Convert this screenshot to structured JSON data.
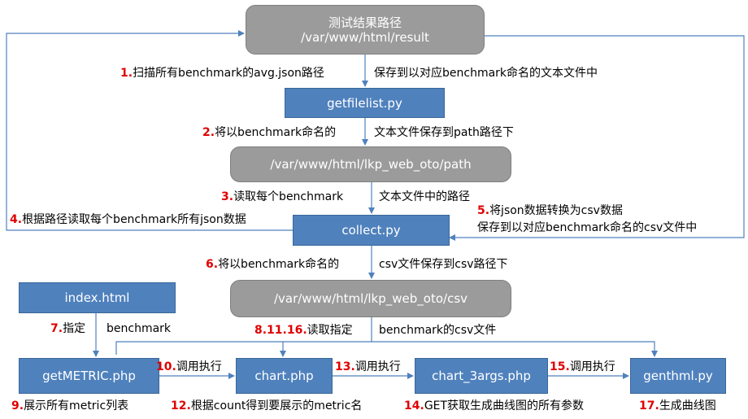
{
  "nodes": {
    "result": {
      "line1": "测试结果路径",
      "line2": "/var/www/html/result"
    },
    "getfilelist": "getfilelist.py",
    "path": "/var/www/html/lkp_web_oto/path",
    "collect": "collect.py",
    "csv": "/var/www/html/lkp_web_oto/csv",
    "index": "index.html",
    "getmetric": "getMETRIC.php",
    "chart": "chart.php",
    "chart3": "chart_3args.php",
    "genthml": "genthml.py"
  },
  "labels": {
    "s1": {
      "num": "1.",
      "text": "扫描所有benchmark的avg.json路径"
    },
    "s1b": {
      "text": "保存到以对应benchmark命名的文本文件中"
    },
    "s2": {
      "num": "2.",
      "text": "将以benchmark命名的"
    },
    "s2b": {
      "text": "文本文件保存到path路径下"
    },
    "s3": {
      "num": "3.",
      "text": "读取每个benchmark"
    },
    "s3b": {
      "text": "文本文件中的路径"
    },
    "s4": {
      "num": "4.",
      "text": "根据路径读取每个benchmark所有json数据"
    },
    "s5": {
      "num": "5.",
      "text": "将json数据转换为csv数据"
    },
    "s5b": {
      "text": "保存到以对应benchmark命名的csv文件中"
    },
    "s6": {
      "num": "6.",
      "text": "将以benchmark命名的"
    },
    "s6b": {
      "text": "csv文件保存到csv路径下"
    },
    "s7": {
      "num": "7.",
      "text": "指定"
    },
    "s7b": {
      "text": "benchmark"
    },
    "s8": {
      "num": "8.11.16.",
      "text": "读取指定"
    },
    "s8b": {
      "text": "benchmark的csv文件"
    },
    "s9": {
      "num": "9.",
      "text": "展示所有metric列表"
    },
    "s10": {
      "num": "10.",
      "text": "调用执行"
    },
    "s12": {
      "num": "12.",
      "text": "根据count得到要展示的metric名"
    },
    "s13": {
      "num": "13.",
      "text": "调用执行"
    },
    "s14": {
      "num": "14.",
      "text": "GET获取生成曲线图的所有参数"
    },
    "s15": {
      "num": "15.",
      "text": "调用执行"
    },
    "s17": {
      "num": "17.",
      "text": "生成曲线图"
    }
  },
  "colors": {
    "arrow": "#4f81bd",
    "grey_box": "#9b9b9b",
    "blue_box": "#4f81bd",
    "step_number": "#e00000"
  }
}
